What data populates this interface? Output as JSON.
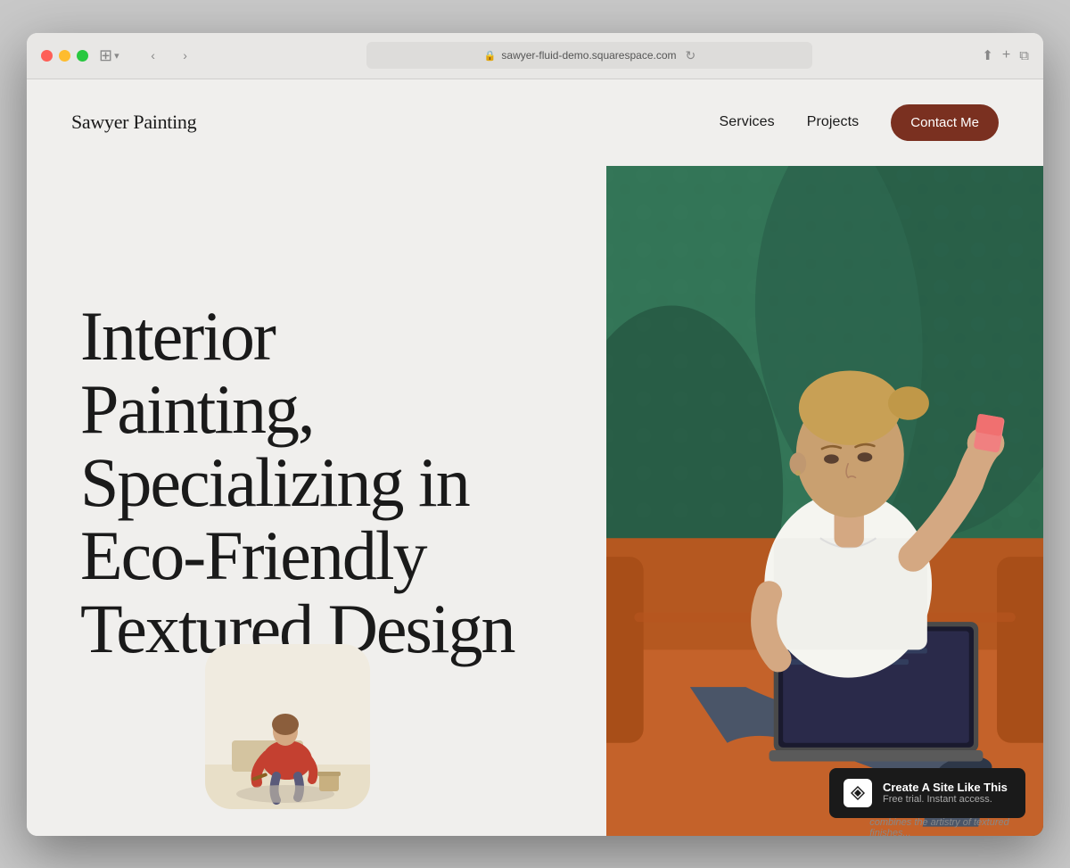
{
  "browser": {
    "url": "sawyer-fluid-demo.squarespace.com",
    "back_label": "‹",
    "forward_label": "›"
  },
  "nav": {
    "logo": "Sawyer Painting",
    "links": [
      {
        "label": "Services",
        "href": "#"
      },
      {
        "label": "Projects",
        "href": "#"
      }
    ],
    "cta": "Contact Me"
  },
  "hero": {
    "title_line1": "Interior",
    "title_line2": "Painting,",
    "title_line3": "Specializing in",
    "title_line4": "Eco-Friendly",
    "title_line5": "Textured Design",
    "caption": "I'm Maria, a skilled painter who combines the artistry of textured finishes..."
  },
  "squarespace": {
    "title": "Create A Site Like This",
    "subtitle": "Free trial. Instant access."
  }
}
